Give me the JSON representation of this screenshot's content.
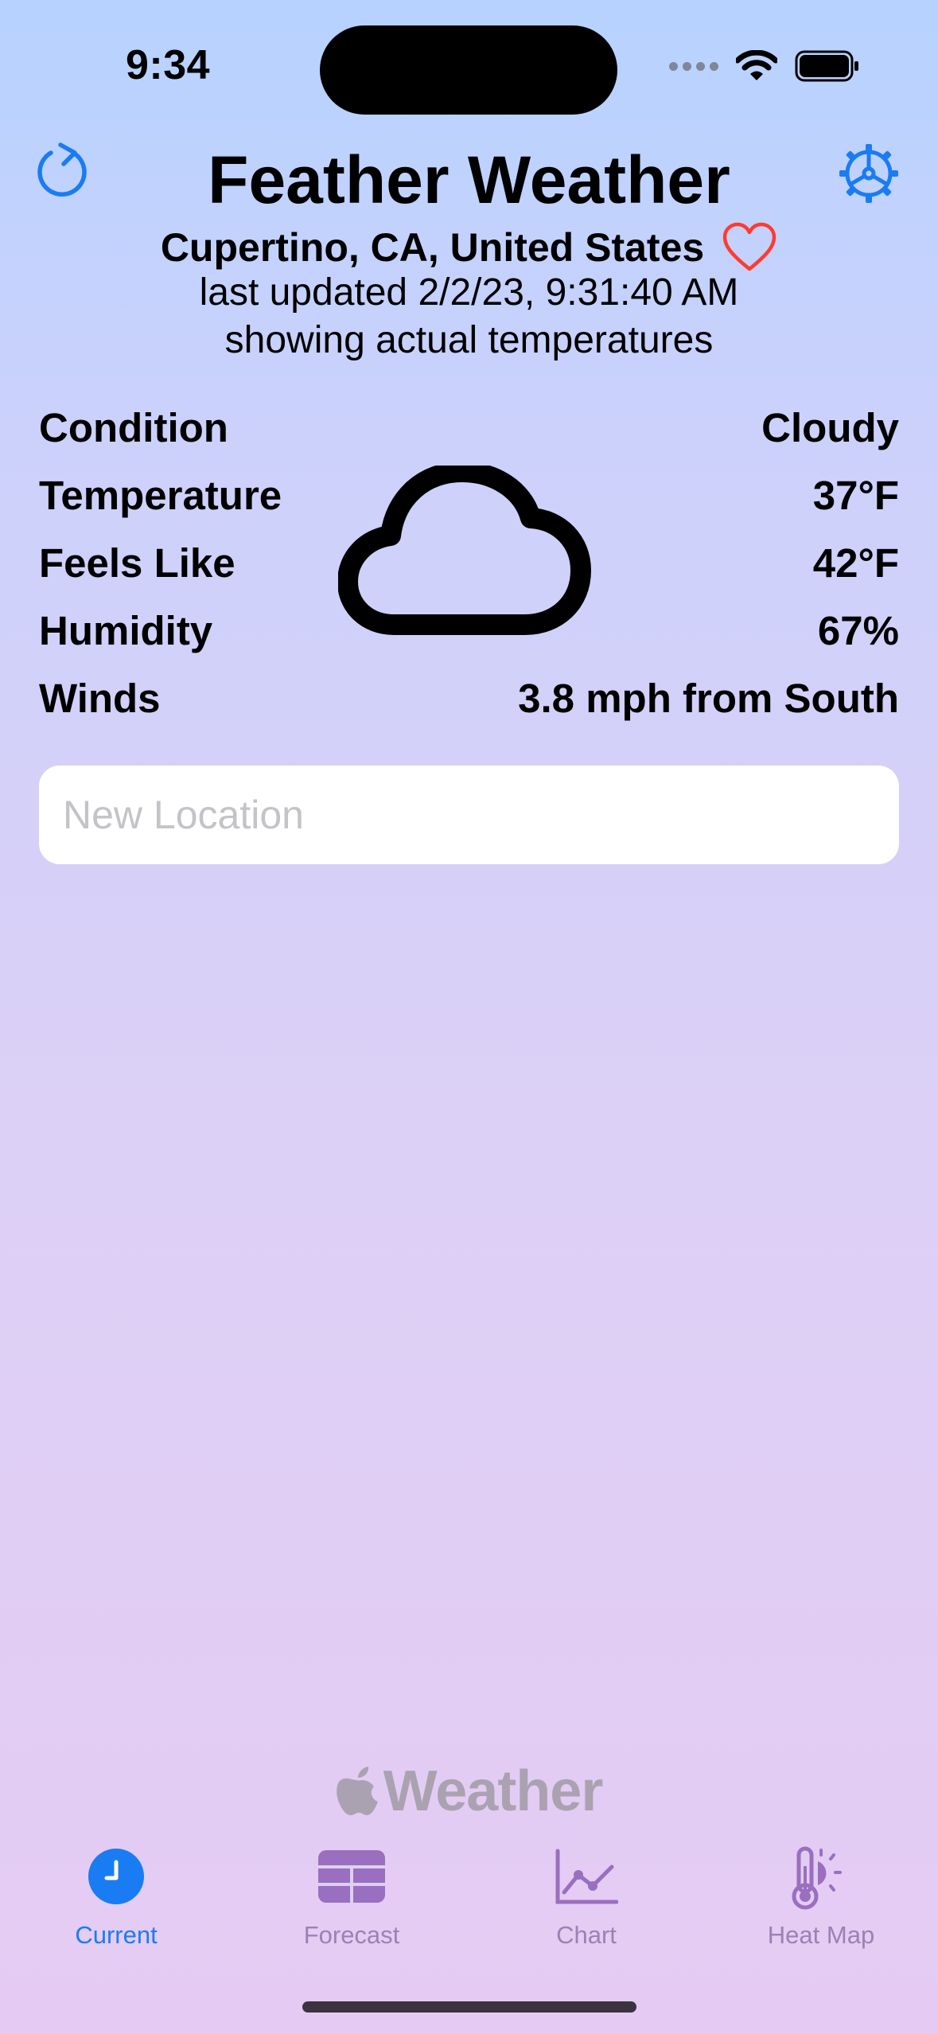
{
  "status_bar": {
    "time": "9:34"
  },
  "header": {
    "title": "Feather Weather",
    "location": "Cupertino, CA, United States",
    "last_updated": "last updated  2/2/23, 9:31:40 AM",
    "mode": "showing actual temperatures"
  },
  "conditions": {
    "rows": [
      {
        "label": "Condition",
        "value": "Cloudy"
      },
      {
        "label": "Temperature",
        "value": "37°F"
      },
      {
        "label": "Feels Like",
        "value": "42°F"
      },
      {
        "label": "Humidity",
        "value": "67%"
      },
      {
        "label": "Winds",
        "value": "3.8 mph from South"
      }
    ],
    "icon": "cloud-icon"
  },
  "new_location": {
    "placeholder": "New Location",
    "value": ""
  },
  "attribution": {
    "text": "Weather"
  },
  "tabs": [
    {
      "label": "Current",
      "icon": "clock-icon",
      "active": true
    },
    {
      "label": "Forecast",
      "icon": "table-icon",
      "active": false
    },
    {
      "label": "Chart",
      "icon": "line-chart-icon",
      "active": false
    },
    {
      "label": "Heat Map",
      "icon": "thermometer-sun-icon",
      "active": false
    }
  ],
  "colors": {
    "accent": "#1a7cf2",
    "heart": "#ff3b30",
    "tab_inactive": "#9a82b5"
  }
}
